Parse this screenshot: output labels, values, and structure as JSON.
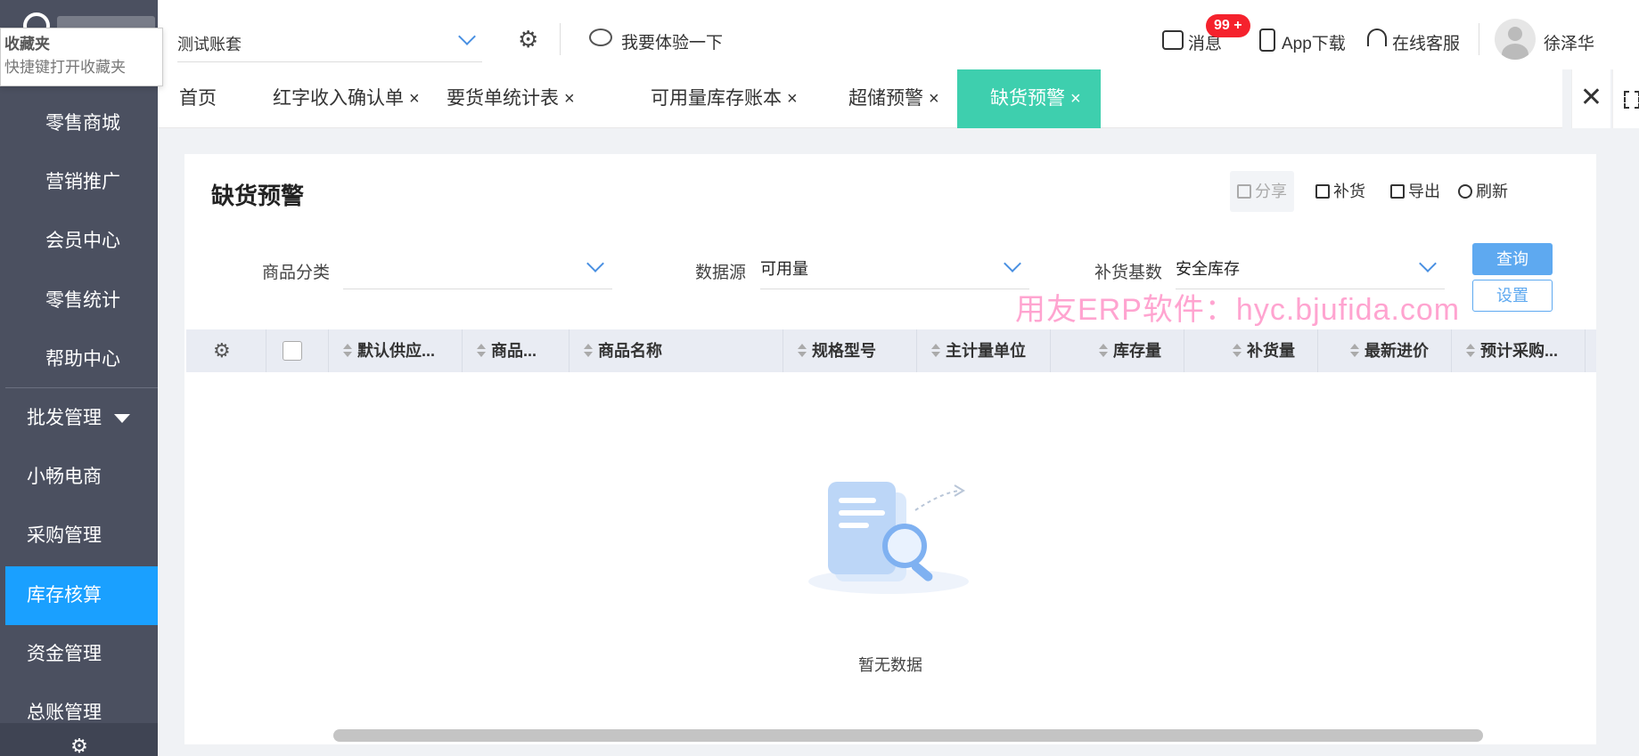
{
  "bookmark_tip": {
    "title": "收藏夹",
    "hint": "快捷键打开收藏夹"
  },
  "sidebar": {
    "sub_items": [
      {
        "label": "零售商城"
      },
      {
        "label": "营销推广"
      },
      {
        "label": "会员中心"
      },
      {
        "label": "零售统计"
      },
      {
        "label": "帮助中心"
      }
    ],
    "items": [
      {
        "label": "批发管理",
        "expandable": true
      },
      {
        "label": "小畅电商"
      },
      {
        "label": "采购管理"
      },
      {
        "label": "库存核算",
        "active": true
      },
      {
        "label": "资金管理"
      },
      {
        "label": "总账管理"
      }
    ],
    "active_color": "#1aa0ff",
    "background": "#4b5060"
  },
  "header": {
    "account": "测试账套",
    "try_label": "我要体验一下",
    "messages_label": "消息",
    "messages_badge": "99 +",
    "app_download": "App下载",
    "online_service": "在线客服",
    "user_name": "徐泽华"
  },
  "tabs": [
    {
      "label": "首页",
      "closable": false
    },
    {
      "label": "红字收入确认单",
      "closable": true
    },
    {
      "label": "要货单统计表",
      "closable": true
    },
    {
      "label": "可用量库存账本",
      "closable": true
    },
    {
      "label": "超储预警",
      "closable": true
    },
    {
      "label": "缺货预警",
      "closable": true,
      "active": true
    }
  ],
  "tab_close_glyph": "×",
  "tab_close_all_glyph": "✕",
  "page": {
    "title": "缺货预警",
    "toolbar": {
      "share": "分享",
      "replenish": "补货",
      "export": "导出",
      "refresh": "刷新"
    },
    "filters": {
      "category_label": "商品分类",
      "category_value": "",
      "source_label": "数据源",
      "source_value": "可用量",
      "base_label": "补货基数",
      "base_value": "安全库存"
    },
    "query_button": "查询",
    "setting_button": "设置",
    "watermark": "用友ERP软件：hyc.bjufida.com",
    "columns": [
      "默认供应...",
      "商品...",
      "商品名称",
      "规格型号",
      "主计量单位",
      "库存量",
      "补货量",
      "最新进价",
      "预计采购..."
    ],
    "empty_text": "暂无数据"
  },
  "colors": {
    "accent_tab": "#3ecfae",
    "primary_button": "#5ea9f0",
    "badge": "#f5222d"
  }
}
